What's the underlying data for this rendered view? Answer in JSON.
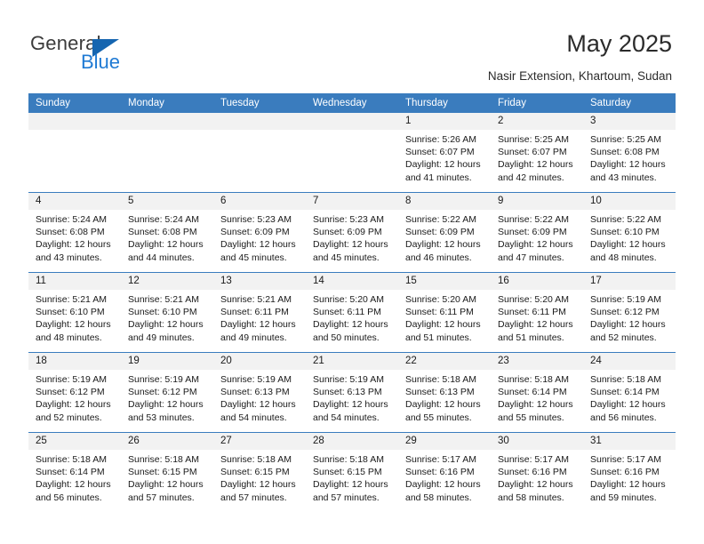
{
  "brand": {
    "name_part1": "General",
    "name_part2": "Blue",
    "triangle_color": "#1565b0",
    "blue_color": "#1f7ad4"
  },
  "header": {
    "title": "May 2025",
    "subtitle": "Nasir Extension, Khartoum, Sudan"
  },
  "theme": {
    "header_bg": "#3a7cbe",
    "daynum_bg": "#f2f2f2",
    "grid_line": "#3a7cbe"
  },
  "weekday_headers": [
    "Sunday",
    "Monday",
    "Tuesday",
    "Wednesday",
    "Thursday",
    "Friday",
    "Saturday"
  ],
  "labels": {
    "sunrise_prefix": "Sunrise:",
    "sunset_prefix": "Sunset:",
    "daylight_prefix": "Daylight:"
  },
  "weeks": [
    [
      {
        "day": "",
        "empty": true,
        "line1": "",
        "line2": "",
        "line3": "",
        "line4": ""
      },
      {
        "day": "",
        "empty": true,
        "line1": "",
        "line2": "",
        "line3": "",
        "line4": ""
      },
      {
        "day": "",
        "empty": true,
        "line1": "",
        "line2": "",
        "line3": "",
        "line4": ""
      },
      {
        "day": "",
        "empty": true,
        "line1": "",
        "line2": "",
        "line3": "",
        "line4": ""
      },
      {
        "day": "1",
        "empty": false,
        "line1": "Sunrise: 5:26 AM",
        "line2": "Sunset: 6:07 PM",
        "line3": "Daylight: 12 hours",
        "line4": "and 41 minutes."
      },
      {
        "day": "2",
        "empty": false,
        "line1": "Sunrise: 5:25 AM",
        "line2": "Sunset: 6:07 PM",
        "line3": "Daylight: 12 hours",
        "line4": "and 42 minutes."
      },
      {
        "day": "3",
        "empty": false,
        "line1": "Sunrise: 5:25 AM",
        "line2": "Sunset: 6:08 PM",
        "line3": "Daylight: 12 hours",
        "line4": "and 43 minutes."
      }
    ],
    [
      {
        "day": "4",
        "empty": false,
        "line1": "Sunrise: 5:24 AM",
        "line2": "Sunset: 6:08 PM",
        "line3": "Daylight: 12 hours",
        "line4": "and 43 minutes."
      },
      {
        "day": "5",
        "empty": false,
        "line1": "Sunrise: 5:24 AM",
        "line2": "Sunset: 6:08 PM",
        "line3": "Daylight: 12 hours",
        "line4": "and 44 minutes."
      },
      {
        "day": "6",
        "empty": false,
        "line1": "Sunrise: 5:23 AM",
        "line2": "Sunset: 6:09 PM",
        "line3": "Daylight: 12 hours",
        "line4": "and 45 minutes."
      },
      {
        "day": "7",
        "empty": false,
        "line1": "Sunrise: 5:23 AM",
        "line2": "Sunset: 6:09 PM",
        "line3": "Daylight: 12 hours",
        "line4": "and 45 minutes."
      },
      {
        "day": "8",
        "empty": false,
        "line1": "Sunrise: 5:22 AM",
        "line2": "Sunset: 6:09 PM",
        "line3": "Daylight: 12 hours",
        "line4": "and 46 minutes."
      },
      {
        "day": "9",
        "empty": false,
        "line1": "Sunrise: 5:22 AM",
        "line2": "Sunset: 6:09 PM",
        "line3": "Daylight: 12 hours",
        "line4": "and 47 minutes."
      },
      {
        "day": "10",
        "empty": false,
        "line1": "Sunrise: 5:22 AM",
        "line2": "Sunset: 6:10 PM",
        "line3": "Daylight: 12 hours",
        "line4": "and 48 minutes."
      }
    ],
    [
      {
        "day": "11",
        "empty": false,
        "line1": "Sunrise: 5:21 AM",
        "line2": "Sunset: 6:10 PM",
        "line3": "Daylight: 12 hours",
        "line4": "and 48 minutes."
      },
      {
        "day": "12",
        "empty": false,
        "line1": "Sunrise: 5:21 AM",
        "line2": "Sunset: 6:10 PM",
        "line3": "Daylight: 12 hours",
        "line4": "and 49 minutes."
      },
      {
        "day": "13",
        "empty": false,
        "line1": "Sunrise: 5:21 AM",
        "line2": "Sunset: 6:11 PM",
        "line3": "Daylight: 12 hours",
        "line4": "and 49 minutes."
      },
      {
        "day": "14",
        "empty": false,
        "line1": "Sunrise: 5:20 AM",
        "line2": "Sunset: 6:11 PM",
        "line3": "Daylight: 12 hours",
        "line4": "and 50 minutes."
      },
      {
        "day": "15",
        "empty": false,
        "line1": "Sunrise: 5:20 AM",
        "line2": "Sunset: 6:11 PM",
        "line3": "Daylight: 12 hours",
        "line4": "and 51 minutes."
      },
      {
        "day": "16",
        "empty": false,
        "line1": "Sunrise: 5:20 AM",
        "line2": "Sunset: 6:11 PM",
        "line3": "Daylight: 12 hours",
        "line4": "and 51 minutes."
      },
      {
        "day": "17",
        "empty": false,
        "line1": "Sunrise: 5:19 AM",
        "line2": "Sunset: 6:12 PM",
        "line3": "Daylight: 12 hours",
        "line4": "and 52 minutes."
      }
    ],
    [
      {
        "day": "18",
        "empty": false,
        "line1": "Sunrise: 5:19 AM",
        "line2": "Sunset: 6:12 PM",
        "line3": "Daylight: 12 hours",
        "line4": "and 52 minutes."
      },
      {
        "day": "19",
        "empty": false,
        "line1": "Sunrise: 5:19 AM",
        "line2": "Sunset: 6:12 PM",
        "line3": "Daylight: 12 hours",
        "line4": "and 53 minutes."
      },
      {
        "day": "20",
        "empty": false,
        "line1": "Sunrise: 5:19 AM",
        "line2": "Sunset: 6:13 PM",
        "line3": "Daylight: 12 hours",
        "line4": "and 54 minutes."
      },
      {
        "day": "21",
        "empty": false,
        "line1": "Sunrise: 5:19 AM",
        "line2": "Sunset: 6:13 PM",
        "line3": "Daylight: 12 hours",
        "line4": "and 54 minutes."
      },
      {
        "day": "22",
        "empty": false,
        "line1": "Sunrise: 5:18 AM",
        "line2": "Sunset: 6:13 PM",
        "line3": "Daylight: 12 hours",
        "line4": "and 55 minutes."
      },
      {
        "day": "23",
        "empty": false,
        "line1": "Sunrise: 5:18 AM",
        "line2": "Sunset: 6:14 PM",
        "line3": "Daylight: 12 hours",
        "line4": "and 55 minutes."
      },
      {
        "day": "24",
        "empty": false,
        "line1": "Sunrise: 5:18 AM",
        "line2": "Sunset: 6:14 PM",
        "line3": "Daylight: 12 hours",
        "line4": "and 56 minutes."
      }
    ],
    [
      {
        "day": "25",
        "empty": false,
        "line1": "Sunrise: 5:18 AM",
        "line2": "Sunset: 6:14 PM",
        "line3": "Daylight: 12 hours",
        "line4": "and 56 minutes."
      },
      {
        "day": "26",
        "empty": false,
        "line1": "Sunrise: 5:18 AM",
        "line2": "Sunset: 6:15 PM",
        "line3": "Daylight: 12 hours",
        "line4": "and 57 minutes."
      },
      {
        "day": "27",
        "empty": false,
        "line1": "Sunrise: 5:18 AM",
        "line2": "Sunset: 6:15 PM",
        "line3": "Daylight: 12 hours",
        "line4": "and 57 minutes."
      },
      {
        "day": "28",
        "empty": false,
        "line1": "Sunrise: 5:18 AM",
        "line2": "Sunset: 6:15 PM",
        "line3": "Daylight: 12 hours",
        "line4": "and 57 minutes."
      },
      {
        "day": "29",
        "empty": false,
        "line1": "Sunrise: 5:17 AM",
        "line2": "Sunset: 6:16 PM",
        "line3": "Daylight: 12 hours",
        "line4": "and 58 minutes."
      },
      {
        "day": "30",
        "empty": false,
        "line1": "Sunrise: 5:17 AM",
        "line2": "Sunset: 6:16 PM",
        "line3": "Daylight: 12 hours",
        "line4": "and 58 minutes."
      },
      {
        "day": "31",
        "empty": false,
        "line1": "Sunrise: 5:17 AM",
        "line2": "Sunset: 6:16 PM",
        "line3": "Daylight: 12 hours",
        "line4": "and 59 minutes."
      }
    ]
  ]
}
